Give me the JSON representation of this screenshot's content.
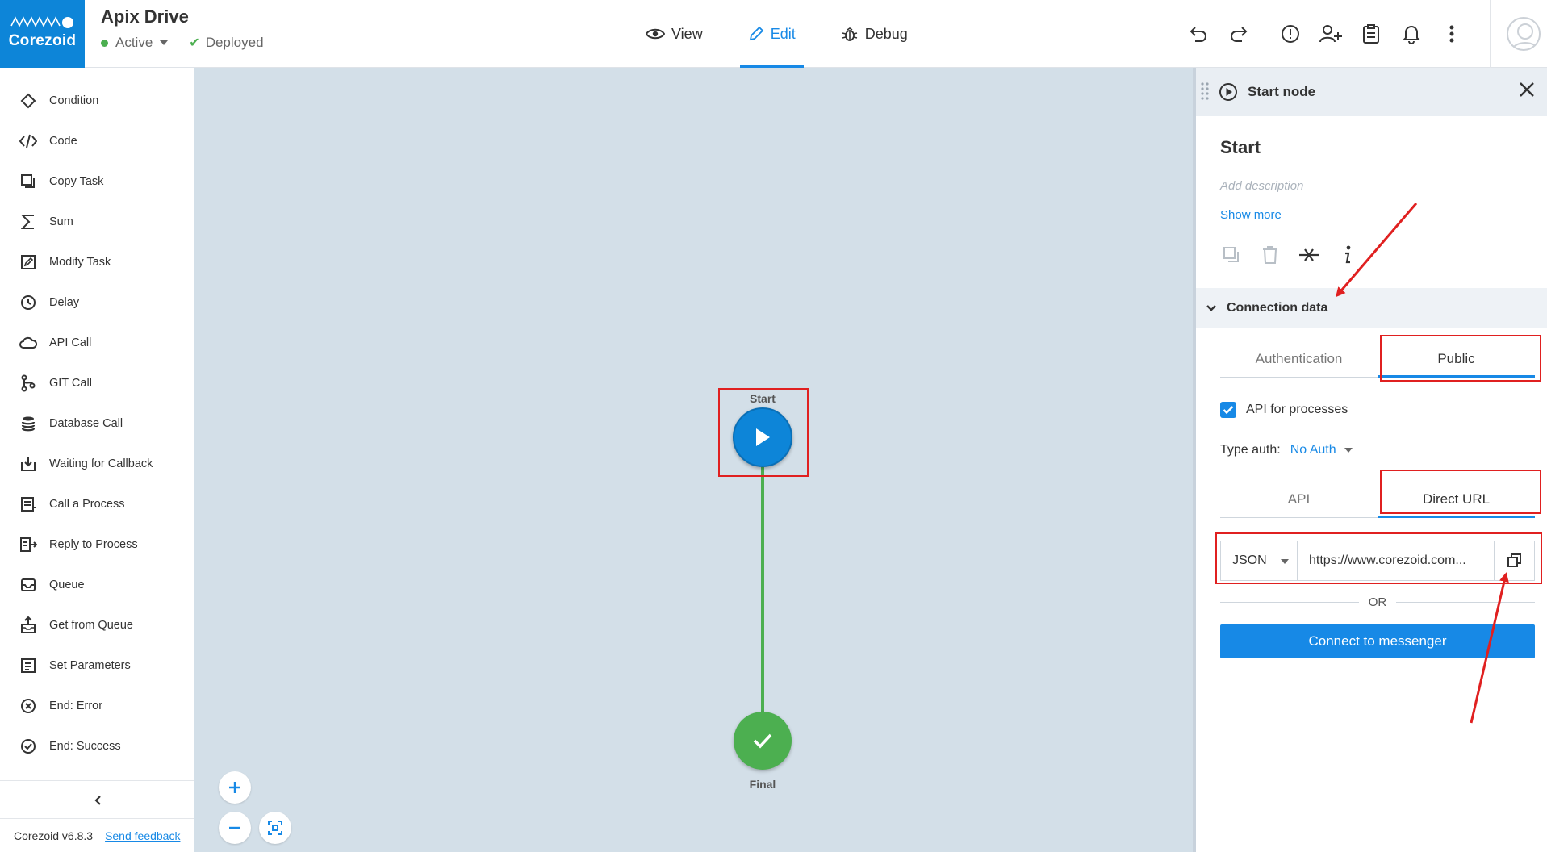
{
  "header": {
    "brand": "Corezoid",
    "project_title": "Apix Drive",
    "status": "Active",
    "deploy_status": "Deployed",
    "modes": [
      {
        "label": "View",
        "icon": "eye-icon"
      },
      {
        "label": "Edit",
        "icon": "pencil-icon"
      },
      {
        "label": "Debug",
        "icon": "bug-icon"
      }
    ],
    "active_mode": "Edit",
    "toolbar_icons": [
      "undo-icon",
      "redo-icon",
      "alert-icon",
      "add-user-icon",
      "clipboard-icon",
      "bell-icon",
      "more-icon"
    ],
    "accent_color": "#1789e6",
    "brand_color": "#0d85d8"
  },
  "sidebar": {
    "items": [
      {
        "label": "Condition",
        "icon": "diamond-icon"
      },
      {
        "label": "Code",
        "icon": "code-icon"
      },
      {
        "label": "Copy Task",
        "icon": "copy-icon"
      },
      {
        "label": "Sum",
        "icon": "sigma-icon"
      },
      {
        "label": "Modify Task",
        "icon": "edit-square-icon"
      },
      {
        "label": "Delay",
        "icon": "clock-icon"
      },
      {
        "label": "API Call",
        "icon": "cloud-icon"
      },
      {
        "label": "GIT Call",
        "icon": "git-icon"
      },
      {
        "label": "Database Call",
        "icon": "database-icon"
      },
      {
        "label": "Waiting for Callback",
        "icon": "download-box-icon"
      },
      {
        "label": "Call a Process",
        "icon": "call-process-icon"
      },
      {
        "label": "Reply to Process",
        "icon": "reply-process-icon"
      },
      {
        "label": "Queue",
        "icon": "inbox-icon"
      },
      {
        "label": "Get from Queue",
        "icon": "upload-box-icon"
      },
      {
        "label": "Set Parameters",
        "icon": "list-box-icon"
      },
      {
        "label": "End: Error",
        "icon": "x-circle-icon"
      },
      {
        "label": "End: Success",
        "icon": "check-circle-icon"
      }
    ],
    "version": "Corezoid v6.8.3",
    "feedback": "Send feedback"
  },
  "canvas": {
    "start_label": "Start",
    "final_label": "Final",
    "edge_color": "#4caf50",
    "start_color": "#0d85d8",
    "final_color": "#4caf50",
    "background": "#d3dfe8"
  },
  "panel": {
    "header_title": "Start node",
    "node_name": "Start",
    "description_placeholder": "Add description",
    "show_more": "Show more",
    "section_title": "Connection data",
    "tabs": [
      {
        "label": "Authentication",
        "active": false
      },
      {
        "label": "Public",
        "active": true
      }
    ],
    "api_for_processes_label": "API for processes",
    "api_for_processes_checked": true,
    "type_auth_label": "Type auth:",
    "type_auth_value": "No Auth",
    "url_tabs": [
      {
        "label": "API",
        "active": false
      },
      {
        "label": "Direct URL",
        "active": true
      }
    ],
    "format": "JSON",
    "url": "https://www.corezoid.com...",
    "or_label": "OR",
    "messenger_button": "Connect to messenger"
  },
  "annotations": {
    "highlight_color": "#e02020"
  }
}
